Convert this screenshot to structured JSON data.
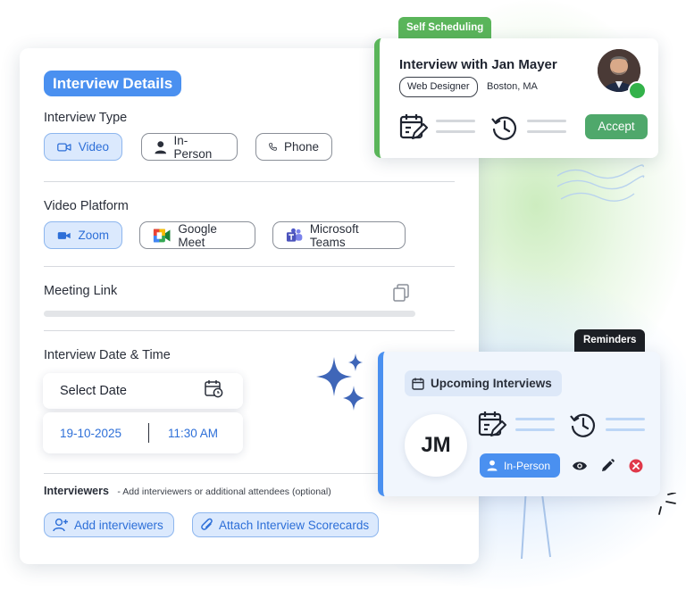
{
  "main_card": {
    "header_pill": "Interview Details",
    "interview_type": {
      "label": "Interview Type",
      "options": [
        {
          "label": "Video",
          "icon": "video-camera-icon",
          "selected": true
        },
        {
          "label": "In-Person",
          "icon": "person-icon",
          "selected": false
        },
        {
          "label": "Phone",
          "icon": "phone-icon",
          "selected": false
        }
      ]
    },
    "video_platform": {
      "label": "Video Platform",
      "options": [
        {
          "label": "Zoom",
          "icon": "zoom-camera-icon",
          "selected": true
        },
        {
          "label": "Google Meet",
          "icon": "google-meet-icon",
          "selected": false
        },
        {
          "label": "Microsoft Teams",
          "icon": "microsoft-teams-icon",
          "selected": false
        }
      ]
    },
    "meeting_link": {
      "label": "Meeting Link",
      "icon": "copy-icon"
    },
    "date_time": {
      "label": "Interview Date & Time",
      "select_date": "Select Date",
      "date": "19-10-2025",
      "time": "11:30 AM"
    },
    "interviewers": {
      "label": "Interviewers",
      "hint": "- Add interviewers or additional attendees (optional)",
      "add_button": "Add interviewers",
      "attach_button": "Attach Interview Scorecards"
    }
  },
  "self_scheduling": {
    "tag": "Self Scheduling",
    "title": "Interview with Jan Mayer",
    "role": "Web Designer",
    "location": "Boston, MA",
    "accept_label": "Accept"
  },
  "reminders": {
    "tag": "Reminders",
    "upcoming_label": "Upcoming Interviews",
    "initials": "JM",
    "mode_label": "In-Person"
  },
  "colors": {
    "primary_blue": "#4a90f0",
    "selected_bg": "#dbe9fd",
    "green": "#5ab55a",
    "accept_green": "#4fa86b",
    "delete_red": "#e0394a",
    "star_blue": "#3f66b8"
  }
}
